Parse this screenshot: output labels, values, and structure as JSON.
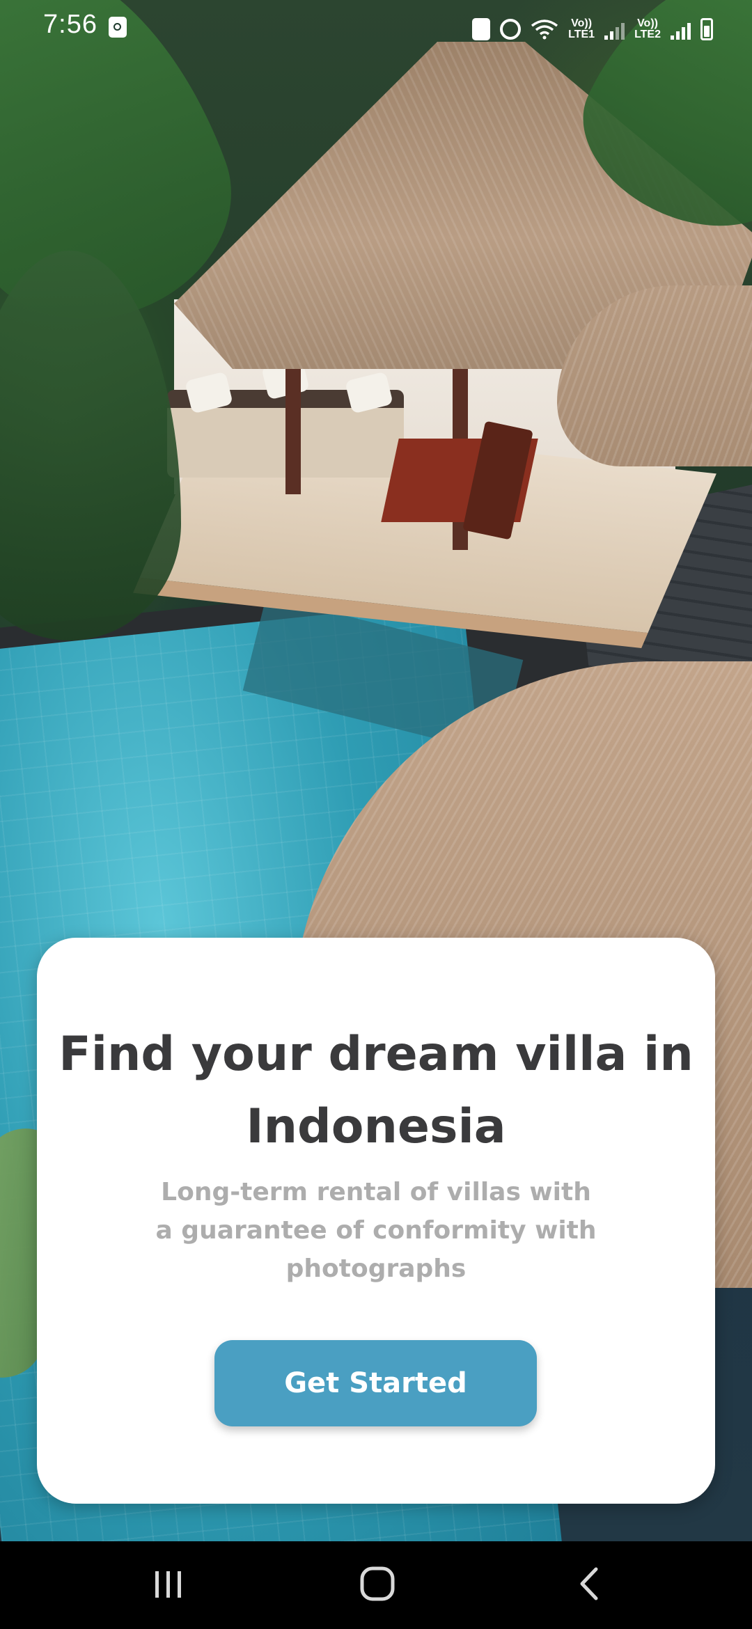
{
  "status_bar": {
    "time": "7:56",
    "sim1_label": "LTE1",
    "sim2_label": "LTE2",
    "volte_label": "Vo))",
    "icons": [
      "screen-recorder-icon",
      "lock-icon",
      "alarm-icon",
      "wifi-icon",
      "signal-icon",
      "battery-icon"
    ]
  },
  "onboarding": {
    "title_line1": "Find your dream villa in",
    "title_line2": "Indonesia",
    "subtitle_line1": "Long-term rental of villas with",
    "subtitle_line2": "a guarantee of conformity with",
    "subtitle_line3": "photographs",
    "cta_label": "Get Started"
  },
  "colors": {
    "accent": "#4a9fc2",
    "title": "#3a3a3c",
    "subtitle": "#adadad",
    "card_background": "#ffffff",
    "nav_bar": "#000000"
  },
  "navigation_bar": {
    "buttons": [
      "recents-icon",
      "home-icon",
      "back-icon"
    ]
  }
}
